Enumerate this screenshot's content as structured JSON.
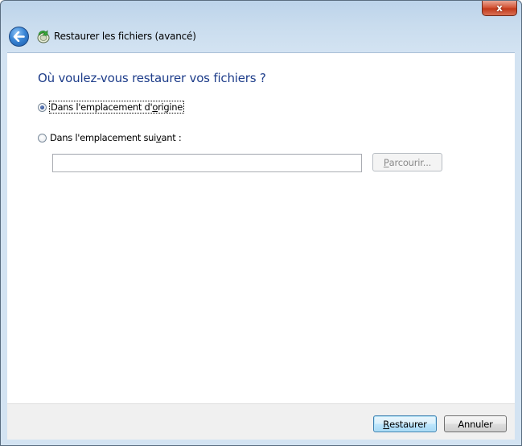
{
  "window": {
    "title": "Restaurer les fichiers (avancé)",
    "close_glyph": "x"
  },
  "main": {
    "heading": "Où voulez-vous restaurer vos fichiers ?",
    "option_original": {
      "label_pre": "Dans l'emplacement d'",
      "label_accel": "o",
      "label_post": "rigine",
      "checked": true
    },
    "option_custom": {
      "label_pre": "Dans l'emplacement sui",
      "label_accel": "v",
      "label_post": "ant :",
      "checked": false
    },
    "path_input": {
      "value": "",
      "placeholder": ""
    },
    "browse": {
      "accel": "P",
      "label_rest": "arcourir..."
    }
  },
  "footer": {
    "restore": {
      "accel": "R",
      "label_rest": "estaurer"
    },
    "cancel_label": "Annuler"
  },
  "colors": {
    "heading": "#1e3d8a",
    "title_bar": "#c9dcee",
    "close_button": "#c23a1c",
    "footer_bg": "#f0f0f0"
  }
}
